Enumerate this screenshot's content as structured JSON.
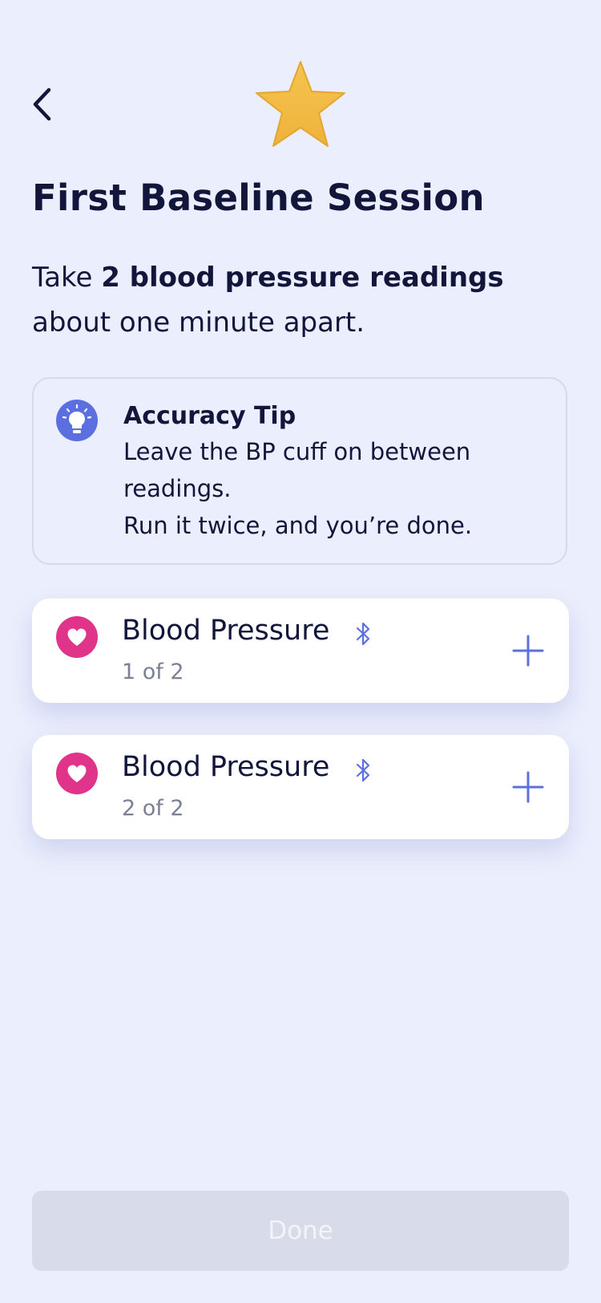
{
  "header": {
    "back_icon": "chevron-left-icon",
    "star_icon": "star-icon"
  },
  "title": "First Baseline Session",
  "subtitle": {
    "prefix": "Take ",
    "emphasis": "2 blood pressure readings",
    "suffix": " about one minute apart."
  },
  "tip": {
    "icon": "lightbulb-icon",
    "heading": "Accuracy Tip",
    "lines": [
      "Leave the BP cuff on between readings.",
      "Run it twice, and you’re done."
    ]
  },
  "readings": [
    {
      "title": "Blood Pressure",
      "count": "1 of 2",
      "icon": "heart-icon",
      "connection_icon": "bluetooth-icon",
      "action_icon": "plus-icon"
    },
    {
      "title": "Blood Pressure",
      "count": "2 of 2",
      "icon": "heart-icon",
      "connection_icon": "bluetooth-icon",
      "action_icon": "plus-icon"
    }
  ],
  "done_label": "Done",
  "colors": {
    "background": "#ebeefc",
    "accent": "#5b6fe0",
    "heart": "#e0338a",
    "star": "#f2bb44",
    "text": "#11163a",
    "muted": "#7c8094",
    "button_disabled": "#d8dbe9"
  }
}
